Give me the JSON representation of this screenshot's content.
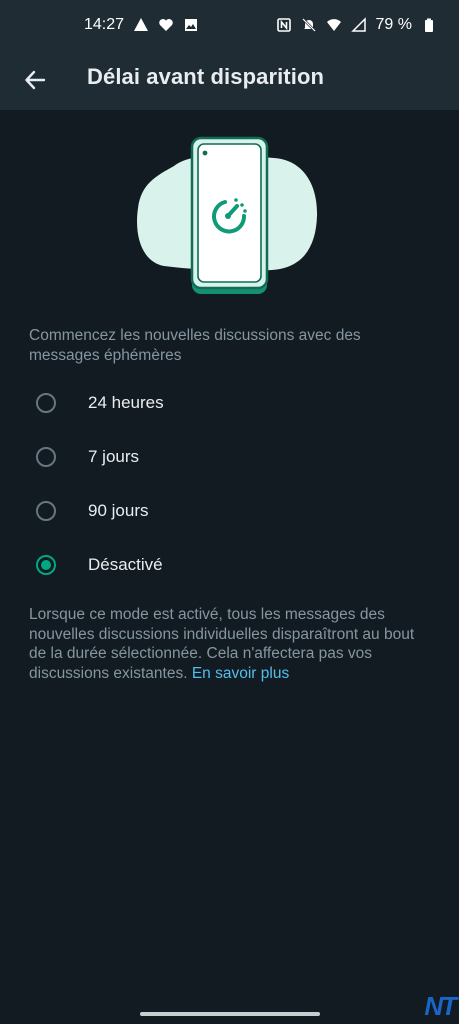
{
  "status_bar": {
    "time": "14:27",
    "battery": "79 %",
    "left_icons": [
      "navigation-icon",
      "heart-icon",
      "image-icon"
    ],
    "right_icons": [
      "nfc-icon",
      "mute-bell-icon",
      "wifi-icon",
      "signal-icon",
      "battery-icon"
    ]
  },
  "header": {
    "title": "Délai avant disparition",
    "back_icon": "arrow-left-icon"
  },
  "intro": "Commencez les nouvelles discussions avec des messages éphémères",
  "options": [
    {
      "label": "24 heures",
      "selected": false
    },
    {
      "label": "7 jours",
      "selected": false
    },
    {
      "label": "90 jours",
      "selected": false
    },
    {
      "label": "Désactivé",
      "selected": true
    }
  ],
  "note": {
    "text": "Lorsque ce mode est activé, tous les messages des nouvelles discussions individuelles disparaîtront au bout de la durée sélectionnée. Cela n'affectera pas vos discussions existantes.",
    "link": "En savoir plus"
  },
  "watermark": "NT",
  "colors": {
    "background": "#121b22",
    "header": "#1f2c34",
    "accent": "#00a884",
    "link": "#53bdeb",
    "secondary_text": "#8696a0"
  }
}
